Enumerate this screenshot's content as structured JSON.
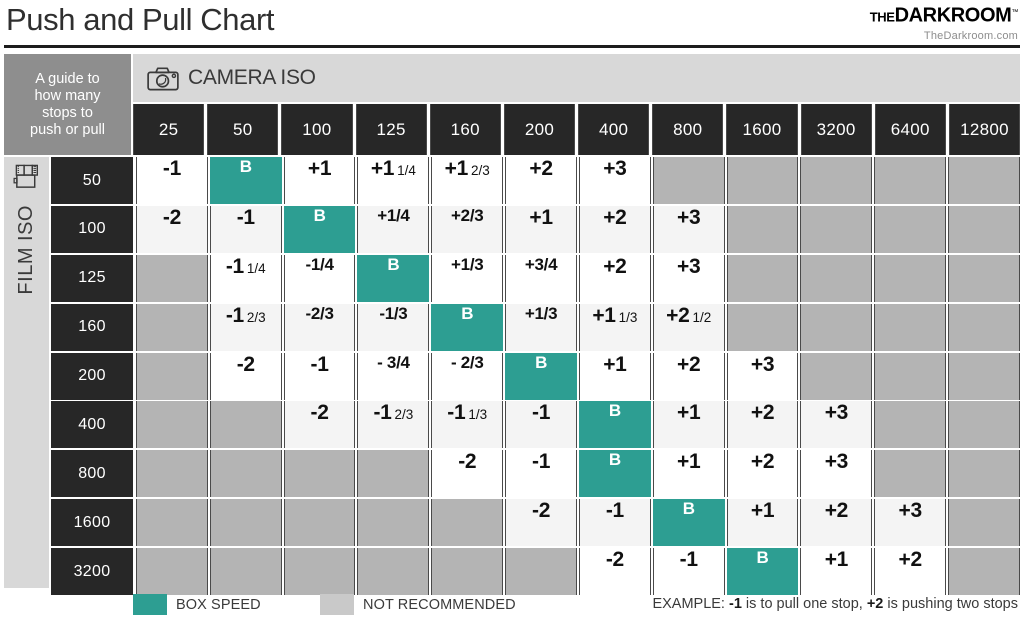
{
  "header": {
    "title": "Push and Pull Chart",
    "brand_the": "THE",
    "brand_dark": "DARK",
    "brand_room": "ROOM",
    "brand_sub": "TheDarkroom.com"
  },
  "guide": {
    "line1": "A guide to",
    "line2": "how many",
    "line3": "stops to",
    "line4": "push or pull"
  },
  "axes": {
    "camera_label": "CAMERA ISO",
    "camera_icon": "camera-icon",
    "film_label": "FILM ISO",
    "film_icon": "film-canister-icon"
  },
  "legend": {
    "box_speed": "BOX SPEED",
    "not_recommended": "NOT RECOMMENDED",
    "example_prefix": "EXAMPLE: ",
    "example_neg": "-1",
    "example_mid": " is to pull one stop, ",
    "example_pos": "+2",
    "example_suffix": " is pushing two stops"
  },
  "colors": {
    "box_speed": "#2d9e92",
    "not_recommended": "#b4b4b4",
    "header_dark": "#272727",
    "band_gray": "#d8d8d8",
    "guide_gray": "#8e8e8e"
  },
  "chart_data": {
    "type": "table",
    "title": "Push and Pull Chart",
    "xlabel": "CAMERA ISO",
    "ylabel": "FILM ISO",
    "columns": [
      "25",
      "50",
      "100",
      "125",
      "160",
      "200",
      "400",
      "800",
      "1600",
      "3200",
      "6400",
      "12800"
    ],
    "rows": [
      "50",
      "100",
      "125",
      "160",
      "200",
      "400",
      "800",
      "1600",
      "3200"
    ],
    "legend_keys": {
      "B": "BOX SPEED",
      "": "NOT RECOMMENDED"
    },
    "cells": [
      [
        {
          "w": "-1",
          "f": "",
          "t": "v"
        },
        {
          "w": "B",
          "f": "",
          "t": "b"
        },
        {
          "w": "+1",
          "f": "",
          "t": "v"
        },
        {
          "w": "+1",
          "f": "1/4",
          "t": "v"
        },
        {
          "w": "+1",
          "f": "2/3",
          "t": "v"
        },
        {
          "w": "+2",
          "f": "",
          "t": "v"
        },
        {
          "w": "+3",
          "f": "",
          "t": "v"
        },
        {
          "w": "",
          "f": "",
          "t": "n"
        },
        {
          "w": "",
          "f": "",
          "t": "n"
        },
        {
          "w": "",
          "f": "",
          "t": "n"
        },
        {
          "w": "",
          "f": "",
          "t": "n"
        },
        {
          "w": "",
          "f": "",
          "t": "n"
        }
      ],
      [
        {
          "w": "-2",
          "f": "",
          "t": "v"
        },
        {
          "w": "-1",
          "f": "",
          "t": "v"
        },
        {
          "w": "B",
          "f": "",
          "t": "b"
        },
        {
          "w": "+1/4",
          "f": "",
          "t": "s"
        },
        {
          "w": "+2/3",
          "f": "",
          "t": "s"
        },
        {
          "w": "+1",
          "f": "",
          "t": "v"
        },
        {
          "w": "+2",
          "f": "",
          "t": "v"
        },
        {
          "w": "+3",
          "f": "",
          "t": "v"
        },
        {
          "w": "",
          "f": "",
          "t": "n"
        },
        {
          "w": "",
          "f": "",
          "t": "n"
        },
        {
          "w": "",
          "f": "",
          "t": "n"
        },
        {
          "w": "",
          "f": "",
          "t": "n"
        }
      ],
      [
        {
          "w": "",
          "f": "",
          "t": "n"
        },
        {
          "w": "-1",
          "f": "1/4",
          "t": "v"
        },
        {
          "w": "-1/4",
          "f": "",
          "t": "s"
        },
        {
          "w": "B",
          "f": "",
          "t": "b"
        },
        {
          "w": "+1/3",
          "f": "",
          "t": "s"
        },
        {
          "w": "+3/4",
          "f": "",
          "t": "s"
        },
        {
          "w": "+2",
          "f": "",
          "t": "v"
        },
        {
          "w": "+3",
          "f": "",
          "t": "v"
        },
        {
          "w": "",
          "f": "",
          "t": "n"
        },
        {
          "w": "",
          "f": "",
          "t": "n"
        },
        {
          "w": "",
          "f": "",
          "t": "n"
        },
        {
          "w": "",
          "f": "",
          "t": "n"
        }
      ],
      [
        {
          "w": "",
          "f": "",
          "t": "n"
        },
        {
          "w": "-1",
          "f": "2/3",
          "t": "v"
        },
        {
          "w": "-2/3",
          "f": "",
          "t": "s"
        },
        {
          "w": "-1/3",
          "f": "",
          "t": "s"
        },
        {
          "w": "B",
          "f": "",
          "t": "b"
        },
        {
          "w": "+1/3",
          "f": "",
          "t": "s"
        },
        {
          "w": "+1",
          "f": "1/3",
          "t": "v"
        },
        {
          "w": "+2",
          "f": "1/2",
          "t": "v"
        },
        {
          "w": "",
          "f": "",
          "t": "n"
        },
        {
          "w": "",
          "f": "",
          "t": "n"
        },
        {
          "w": "",
          "f": "",
          "t": "n"
        },
        {
          "w": "",
          "f": "",
          "t": "n"
        }
      ],
      [
        {
          "w": "",
          "f": "",
          "t": "n"
        },
        {
          "w": "-2",
          "f": "",
          "t": "v"
        },
        {
          "w": "-1",
          "f": "",
          "t": "v"
        },
        {
          "w": "- 3/4",
          "f": "",
          "t": "s"
        },
        {
          "w": "- 2/3",
          "f": "",
          "t": "s"
        },
        {
          "w": "B",
          "f": "",
          "t": "b"
        },
        {
          "w": "+1",
          "f": "",
          "t": "v"
        },
        {
          "w": "+2",
          "f": "",
          "t": "v"
        },
        {
          "w": "+3",
          "f": "",
          "t": "v"
        },
        {
          "w": "",
          "f": "",
          "t": "n"
        },
        {
          "w": "",
          "f": "",
          "t": "n"
        },
        {
          "w": "",
          "f": "",
          "t": "n"
        }
      ],
      [
        {
          "w": "",
          "f": "",
          "t": "n"
        },
        {
          "w": "",
          "f": "",
          "t": "n"
        },
        {
          "w": "-2",
          "f": "",
          "t": "v"
        },
        {
          "w": "-1",
          "f": "2/3",
          "t": "v"
        },
        {
          "w": "-1",
          "f": "1/3",
          "t": "v"
        },
        {
          "w": "-1",
          "f": "",
          "t": "v"
        },
        {
          "w": "B",
          "f": "",
          "t": "b"
        },
        {
          "w": "+1",
          "f": "",
          "t": "v"
        },
        {
          "w": "+2",
          "f": "",
          "t": "v"
        },
        {
          "w": "+3",
          "f": "",
          "t": "v"
        },
        {
          "w": "",
          "f": "",
          "t": "n"
        },
        {
          "w": "",
          "f": "",
          "t": "n"
        }
      ],
      [
        {
          "w": "",
          "f": "",
          "t": "n"
        },
        {
          "w": "",
          "f": "",
          "t": "n"
        },
        {
          "w": "",
          "f": "",
          "t": "n"
        },
        {
          "w": "",
          "f": "",
          "t": "n"
        },
        {
          "w": "-2",
          "f": "",
          "t": "v"
        },
        {
          "w": "-1",
          "f": "",
          "t": "v"
        },
        {
          "w": "B",
          "f": "",
          "t": "b"
        },
        {
          "w": "+1",
          "f": "",
          "t": "v"
        },
        {
          "w": "+2",
          "f": "",
          "t": "v"
        },
        {
          "w": "+3",
          "f": "",
          "t": "v"
        },
        {
          "w": "",
          "f": "",
          "t": "n"
        },
        {
          "w": "",
          "f": "",
          "t": "n"
        }
      ],
      [
        {
          "w": "",
          "f": "",
          "t": "n"
        },
        {
          "w": "",
          "f": "",
          "t": "n"
        },
        {
          "w": "",
          "f": "",
          "t": "n"
        },
        {
          "w": "",
          "f": "",
          "t": "n"
        },
        {
          "w": "",
          "f": "",
          "t": "n"
        },
        {
          "w": "-2",
          "f": "",
          "t": "v"
        },
        {
          "w": "-1",
          "f": "",
          "t": "v"
        },
        {
          "w": "B",
          "f": "",
          "t": "b"
        },
        {
          "w": "+1",
          "f": "",
          "t": "v"
        },
        {
          "w": "+2",
          "f": "",
          "t": "v"
        },
        {
          "w": "+3",
          "f": "",
          "t": "v"
        },
        {
          "w": "",
          "f": "",
          "t": "n"
        }
      ],
      [
        {
          "w": "",
          "f": "",
          "t": "n"
        },
        {
          "w": "",
          "f": "",
          "t": "n"
        },
        {
          "w": "",
          "f": "",
          "t": "n"
        },
        {
          "w": "",
          "f": "",
          "t": "n"
        },
        {
          "w": "",
          "f": "",
          "t": "n"
        },
        {
          "w": "",
          "f": "",
          "t": "n"
        },
        {
          "w": "-2",
          "f": "",
          "t": "v"
        },
        {
          "w": "-1",
          "f": "",
          "t": "v"
        },
        {
          "w": "B",
          "f": "",
          "t": "b"
        },
        {
          "w": "+1",
          "f": "",
          "t": "v"
        },
        {
          "w": "+2",
          "f": "",
          "t": "v"
        },
        {
          "w": "",
          "f": "",
          "t": "n"
        }
      ]
    ]
  }
}
